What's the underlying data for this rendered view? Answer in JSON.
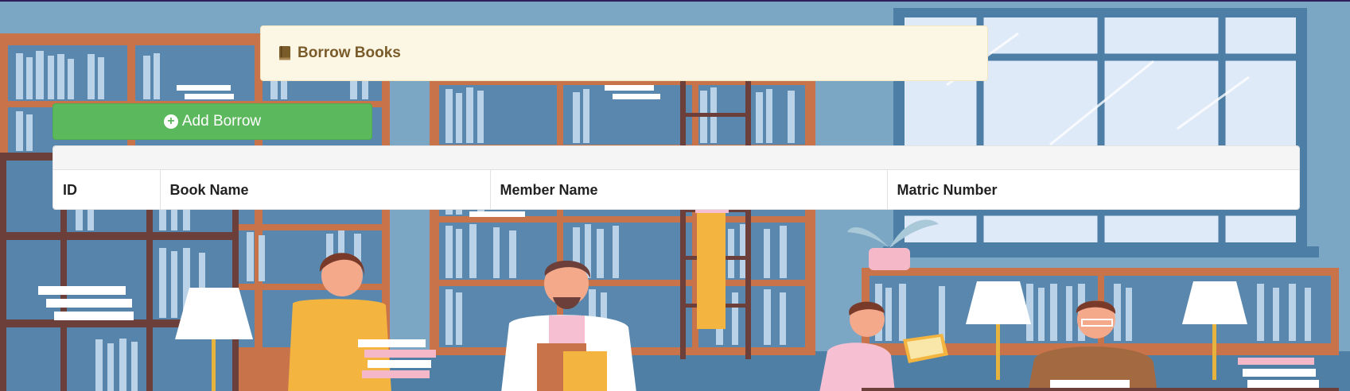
{
  "header": {
    "title": "Borrow Books",
    "icon": "book-icon"
  },
  "actions": {
    "add_borrow_label": "Add Borrow",
    "add_icon": "plus-circle-icon"
  },
  "table": {
    "columns": [
      "ID",
      "Book Name",
      "Member Name",
      "Matric Number"
    ],
    "rows": []
  },
  "colors": {
    "heading_bg": "#fcf6e4",
    "heading_text": "#7a5b2a",
    "button_green": "#5cb85c",
    "background_blue": "#7aa6c2"
  }
}
